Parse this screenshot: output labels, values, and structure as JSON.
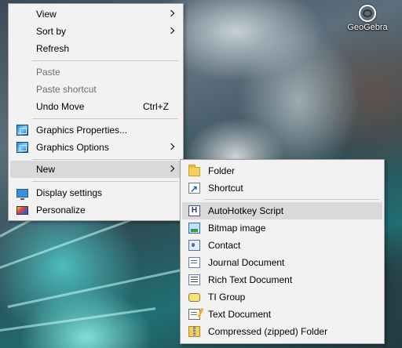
{
  "desktop": {
    "icons": [
      {
        "label": "GeoGebra",
        "icon": "geogebra-icon"
      }
    ]
  },
  "context_menu": {
    "items": [
      {
        "label": "View",
        "has_submenu": true
      },
      {
        "label": "Sort by",
        "has_submenu": true
      },
      {
        "label": "Refresh"
      },
      {
        "label": "Paste",
        "disabled": true
      },
      {
        "label": "Paste shortcut",
        "disabled": true
      },
      {
        "label": "Undo Move",
        "shortcut": "Ctrl+Z"
      },
      {
        "label": "Graphics Properties...",
        "icon": "graphics-icon"
      },
      {
        "label": "Graphics Options",
        "icon": "graphics-icon",
        "has_submenu": true
      },
      {
        "label": "New",
        "has_submenu": true,
        "highlighted": true
      },
      {
        "label": "Display settings",
        "icon": "display-icon"
      },
      {
        "label": "Personalize",
        "icon": "personalize-icon"
      }
    ]
  },
  "new_submenu": {
    "items": [
      {
        "label": "Folder",
        "icon": "folder-icon"
      },
      {
        "label": "Shortcut",
        "icon": "shortcut-icon"
      },
      {
        "label": "AutoHotkey Script",
        "icon": "ahk-script-icon",
        "highlighted": true,
        "icon_glyph": "H"
      },
      {
        "label": "Bitmap image",
        "icon": "bitmap-icon"
      },
      {
        "label": "Contact",
        "icon": "contact-icon"
      },
      {
        "label": "Journal Document",
        "icon": "journal-icon"
      },
      {
        "label": "Rich Text Document",
        "icon": "rich-text-icon"
      },
      {
        "label": "TI Group",
        "icon": "ti-group-icon"
      },
      {
        "label": "Text Document",
        "icon": "text-document-icon"
      },
      {
        "label": "Compressed (zipped) Folder",
        "icon": "zip-folder-icon"
      }
    ]
  }
}
